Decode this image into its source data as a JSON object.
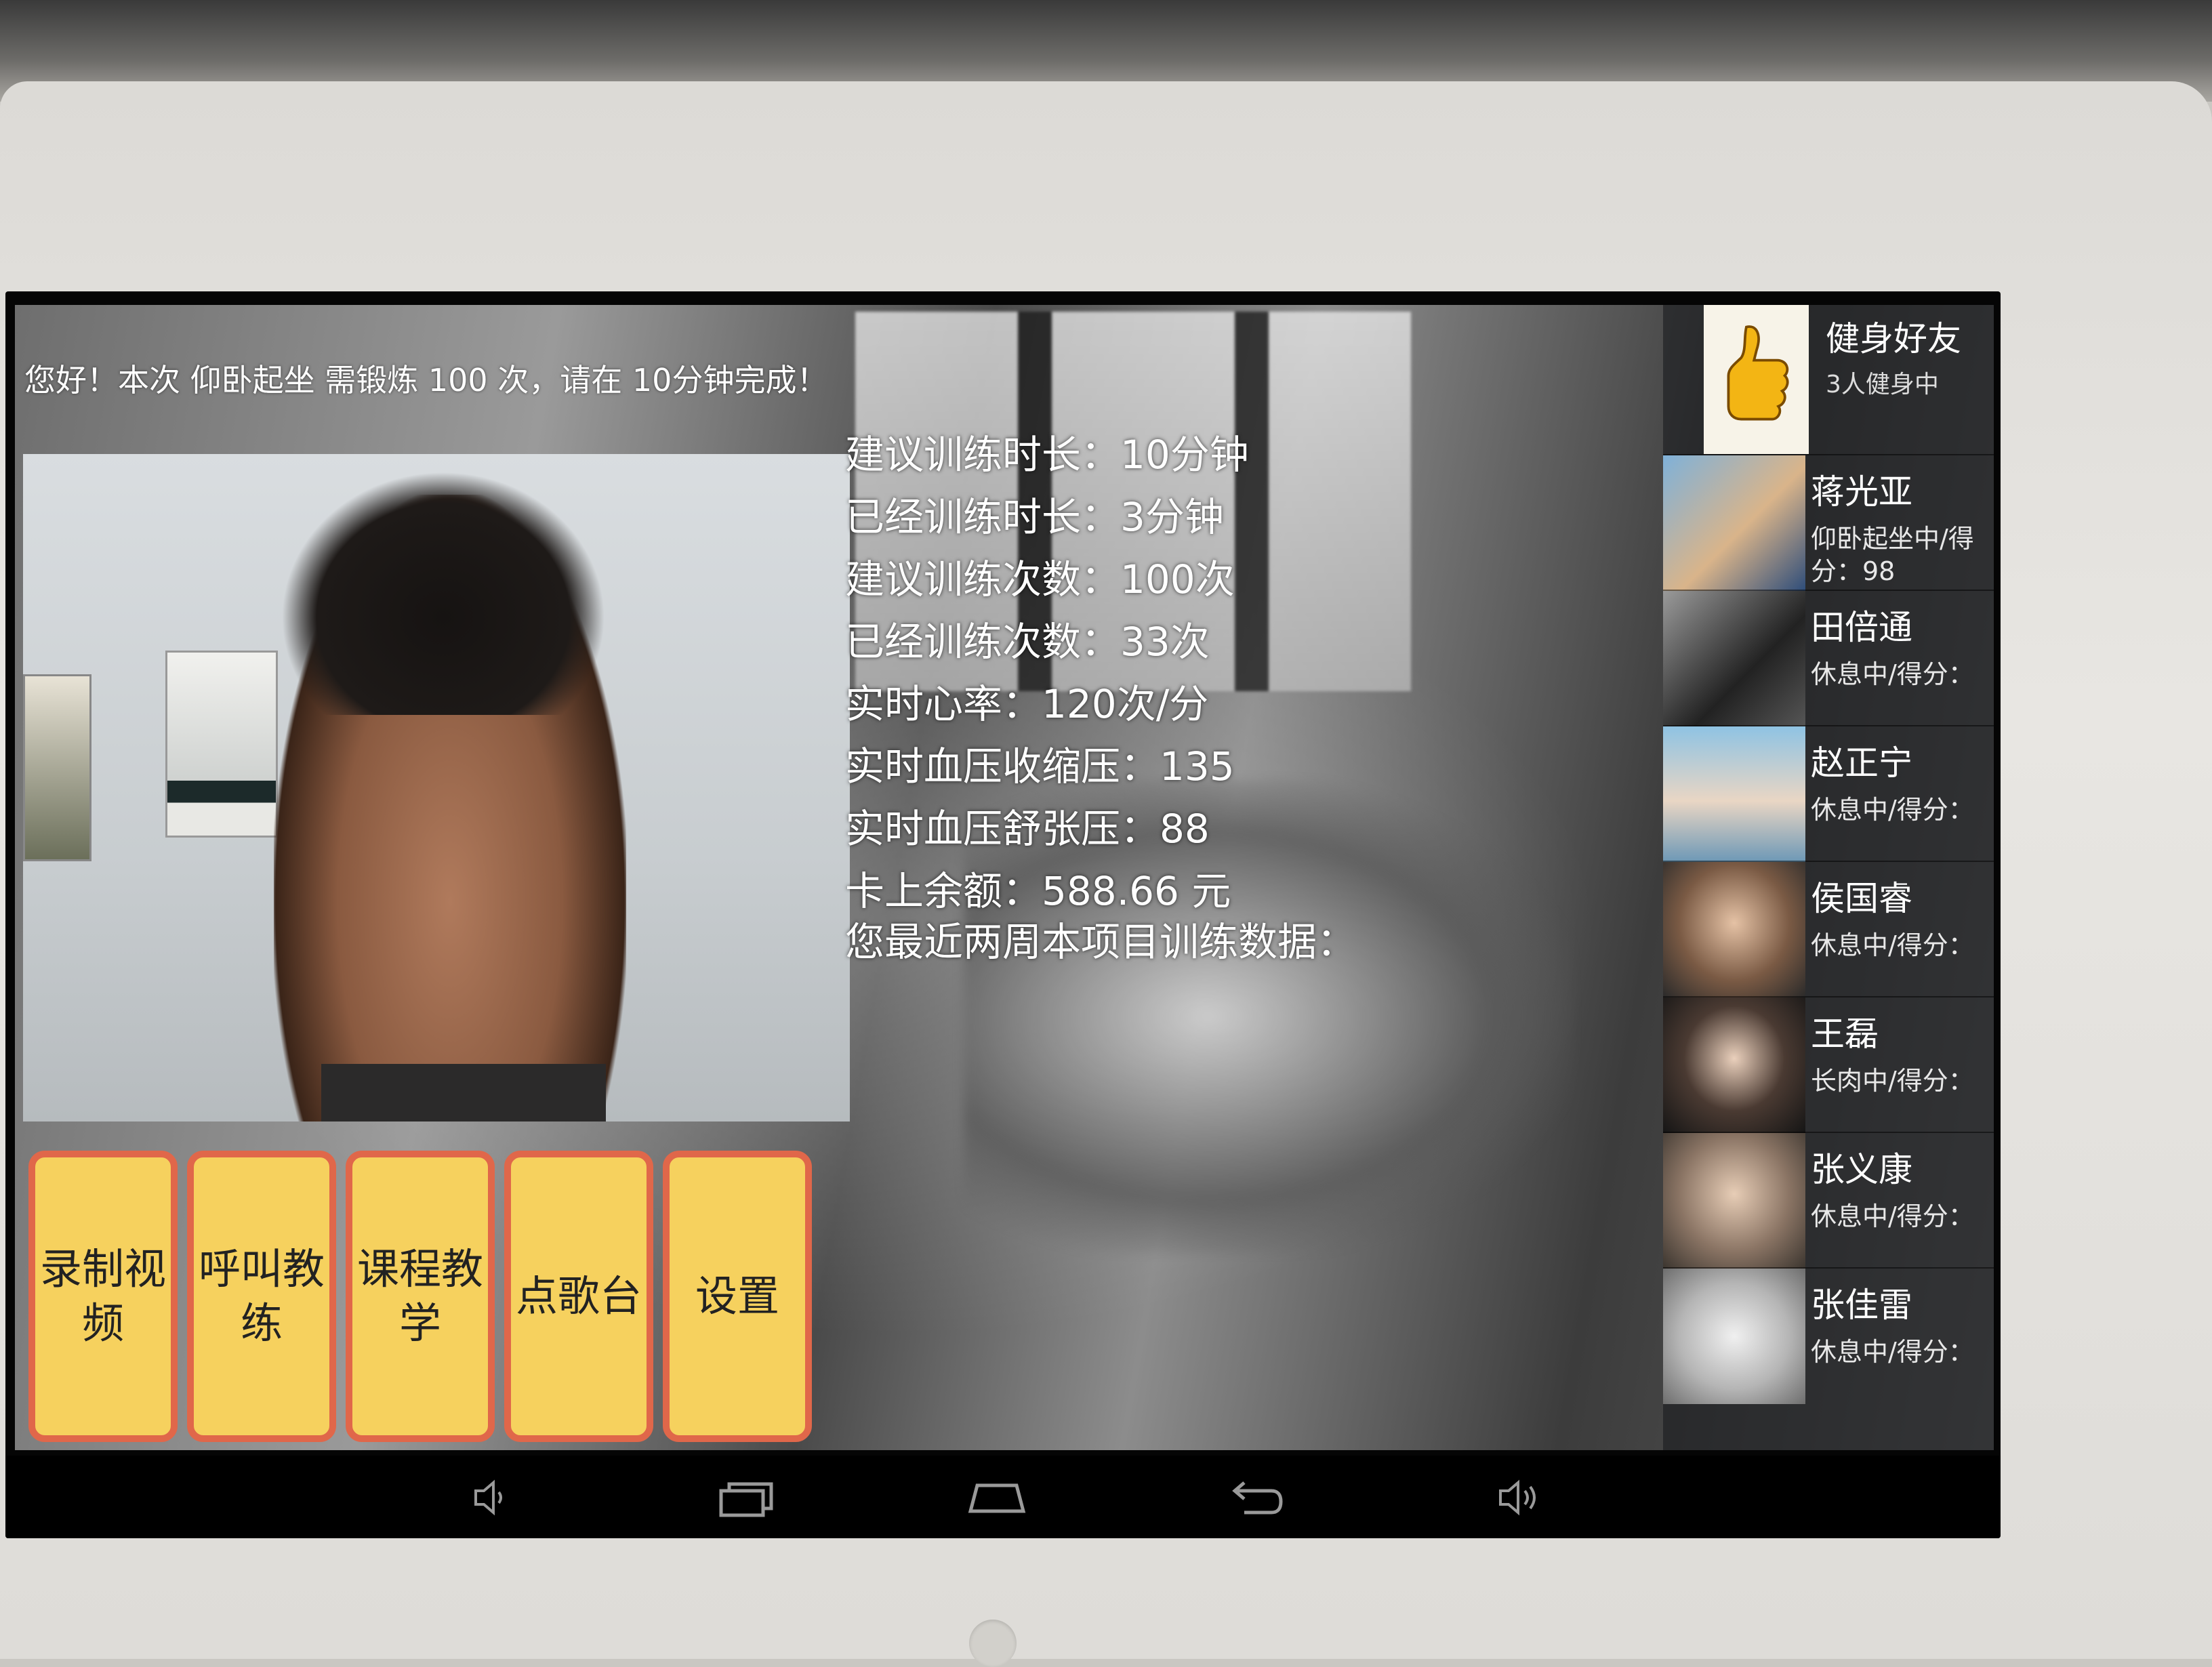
{
  "notice": {
    "text": "您好！本次 仰卧起坐 需锻炼 100 次，请在 10分钟完成！"
  },
  "stats": [
    "建议训练时长：10分钟",
    "已经训练时长：3分钟",
    "建议训练次数：100次",
    "已经训练次数：33次",
    "实时心率：120次/分",
    "实时血压收缩压：135",
    "实时血压舒张压：88",
    "卡上余额：588.66 元",
    "您最近两周本项目训练数据："
  ],
  "actions": [
    {
      "label": "录制视频"
    },
    {
      "label": "呼叫教练"
    },
    {
      "label": "课程教学"
    },
    {
      "label": "点歌台"
    },
    {
      "label": "设置"
    }
  ],
  "friends": {
    "title": "健身好友",
    "count": "3人健身中",
    "icon": "thumbs-up-icon",
    "list": [
      {
        "name": "蒋光亚",
        "status": "仰卧起坐中/得",
        "score": "分：98",
        "avatar_color": "#4a7fb5"
      },
      {
        "name": "田倍通",
        "status": "休息中/得分：",
        "score": "",
        "avatar_color": "#3d3d3d"
      },
      {
        "name": "赵正宁",
        "status": "休息中/得分：",
        "score": "",
        "avatar_color": "#6fa7c9"
      },
      {
        "name": "侯国睿",
        "status": "休息中/得分：",
        "score": "",
        "avatar_color": "#8c6a55"
      },
      {
        "name": "王磊",
        "status": "长肉中/得分：",
        "score": "",
        "avatar_color": "#2d2d2d"
      },
      {
        "name": "张义康",
        "status": "休息中/得分：",
        "score": "",
        "avatar_color": "#7a6a5c"
      },
      {
        "name": "张佳雷",
        "status": "休息中/得分：",
        "score": "",
        "avatar_color": "#b9b9b9"
      }
    ]
  },
  "navbar": {
    "icons": [
      "volume-down-icon",
      "recent-apps-icon",
      "home-icon",
      "back-icon",
      "volume-up-icon"
    ]
  },
  "colors": {
    "button_fill": "#f6d15e",
    "button_border": "#e0674a"
  }
}
